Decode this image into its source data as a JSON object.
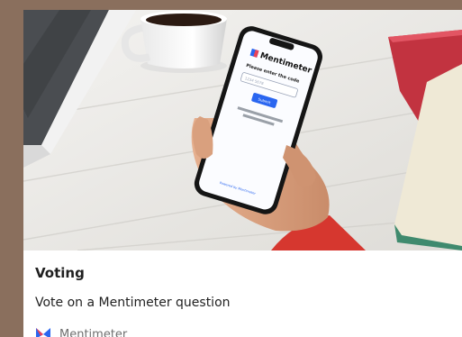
{
  "card": {
    "title": "Voting",
    "description": "Vote on a Mentimeter question",
    "brand": {
      "name": "Mentimeter",
      "icon": "mentimeter-logo-icon"
    },
    "image": {
      "phone_screen": {
        "logo_text": "Mentimeter",
        "heading": "Please enter the code",
        "input_placeholder": "1234 5678",
        "submit_label": "Submit",
        "footer_link": "Powered by Mentimeter"
      }
    }
  },
  "colors": {
    "page_background": "#8a6f5d",
    "card_background": "#ffffff",
    "brand_blue": "#2a66f0",
    "brand_red": "#e8425a",
    "title_text": "#1f1f1f",
    "muted_text": "#6f6f6f"
  }
}
